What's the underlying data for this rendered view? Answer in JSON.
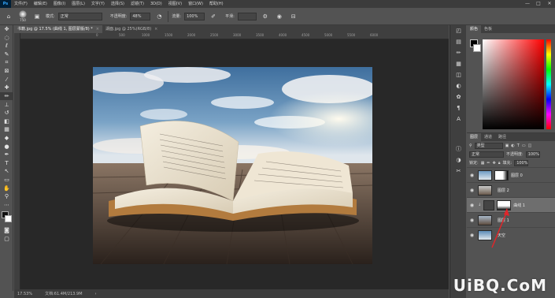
{
  "menubar": {
    "logo": "Ps",
    "items": [
      "文件(F)",
      "编辑(E)",
      "图像(I)",
      "图层(L)",
      "文字(Y)",
      "选择(S)",
      "滤镜(T)",
      "3D(D)",
      "视图(V)",
      "窗口(W)",
      "帮助(H)"
    ],
    "window_controls": [
      "—",
      "□",
      "✕"
    ]
  },
  "options": {
    "brush_size": "750",
    "mode_label": "模式:",
    "mode_value": "正常",
    "opacity_label": "不透明度:",
    "opacity_value": "48%",
    "flow_label": "流量:",
    "flow_value": "100%",
    "smooth_label": "平滑:",
    "smooth_value": ""
  },
  "tabs": [
    {
      "label": "书籍.jpg @ 17.5% (曲线 1, 图层蒙版/8) *",
      "close": "×"
    },
    {
      "label": "湖面.jpg @ 25%(RGB/8)",
      "close": "×"
    }
  ],
  "ruler": [
    "0",
    "500",
    "1000",
    "1500",
    "2000",
    "2500",
    "3000",
    "3500",
    "4000",
    "4500",
    "5000",
    "5500",
    "6000"
  ],
  "status": {
    "zoom": "17.53%",
    "doc": "文档:61.4M/213.9M",
    "arrow": "›"
  },
  "panels": {
    "color_tabs": [
      "颜色",
      "色板"
    ],
    "layer_tabs": [
      "图层",
      "通道",
      "路径"
    ],
    "filter_kind": "类型",
    "blend_mode": "正常",
    "opacity_label": "不透明度:",
    "opacity_value": "100%",
    "lock_label": "锁定:",
    "fill_label": "填充:",
    "fill_value": "100%"
  },
  "layers": [
    {
      "name": "图层 0",
      "thumb": "sky-mask"
    },
    {
      "name": "图层 2",
      "thumb": "book"
    },
    {
      "name": "曲线 1",
      "thumb": "mask",
      "selected": true
    },
    {
      "name": "图层 1",
      "thumb": "book"
    },
    {
      "name": "天空",
      "thumb": "sky"
    }
  ],
  "watermark": "UiBQ.CoM",
  "colors": {
    "accent": "#31a8ff",
    "annotation": "#e0262a"
  }
}
